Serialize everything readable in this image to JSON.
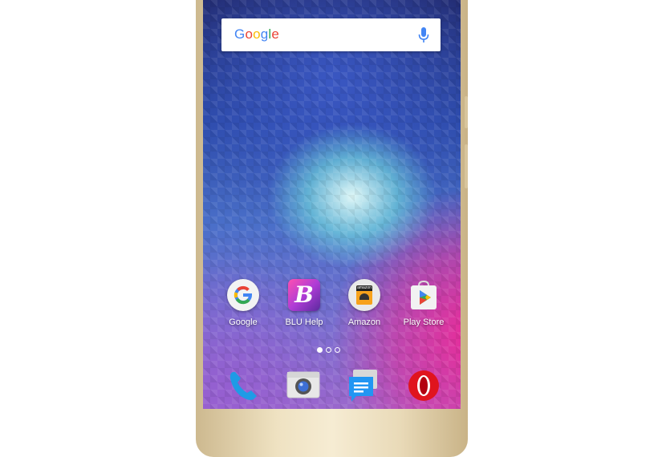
{
  "search": {
    "logo_text": "Google",
    "mic_icon": "mic-icon"
  },
  "apps": [
    {
      "label": "Google",
      "icon": "google-g-icon"
    },
    {
      "label": "BLU Help",
      "icon": "blu-help-icon",
      "glyph": "B"
    },
    {
      "label": "Amazon",
      "icon": "amazon-icon",
      "glyph": "amazon"
    },
    {
      "label": "Play Store",
      "icon": "play-store-icon"
    }
  ],
  "page_indicator": {
    "pages": 3,
    "current": 1
  },
  "dock": [
    {
      "icon": "phone-icon"
    },
    {
      "icon": "camera-icon"
    },
    {
      "icon": "messaging-icon"
    },
    {
      "icon": "opera-browser-icon"
    }
  ],
  "colors": {
    "frame_gold": "#efe2c2",
    "google_blue": "#4285f4",
    "google_red": "#ea4335",
    "google_yellow": "#fbbc05",
    "google_green": "#34a853",
    "phone_blue": "#1e9be6",
    "opera_red": "#e0141e"
  }
}
